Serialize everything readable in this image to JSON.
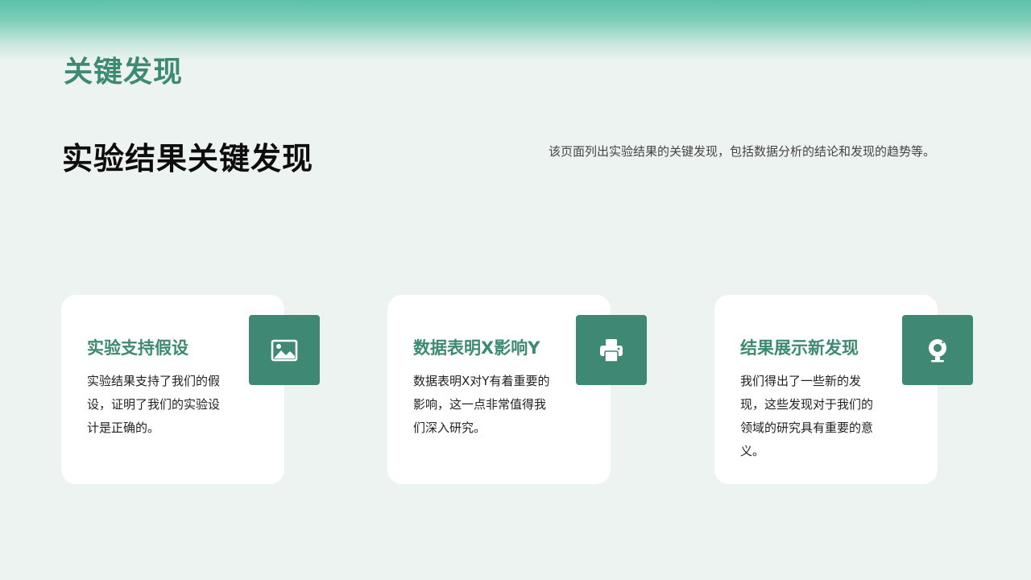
{
  "slide": {
    "title": "关键发现",
    "heading": "实验结果关键发现",
    "subtitle": "该页面列出实验结果的关键发现，包括数据分析的结论和发现的趋势等。"
  },
  "cards": [
    {
      "title": "实验支持假设",
      "text": "实验结果支持了我们的假设，证明了我们的实验设计是正确的。",
      "icon": "image-icon"
    },
    {
      "title": "数据表明X影响Y",
      "text": "数据表明X对Y有着重要的影响，这一点非常值得我们深入研究。",
      "icon": "printer-icon"
    },
    {
      "title": "结果展示新发现",
      "text": "我们得出了一些新的发现，这些发现对于我们的领域的研究具有重要的意义。",
      "icon": "webcam-icon"
    }
  ],
  "colors": {
    "accent": "#3d8a72",
    "icon_bg": "#3f8873",
    "background": "#edf3f0",
    "card": "#ffffff"
  }
}
